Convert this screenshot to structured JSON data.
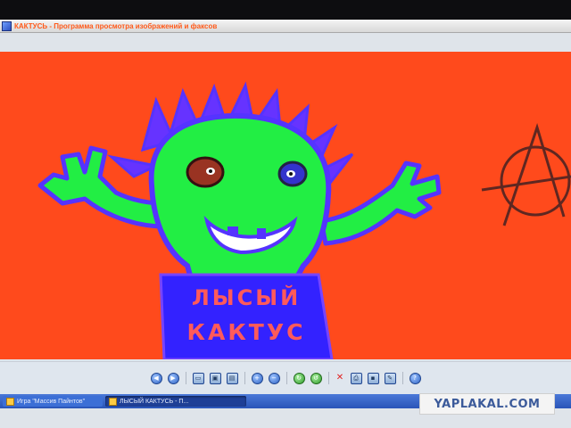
{
  "window": {
    "title": "КАКТУСЬ - Программа просмотра изображений и факсов"
  },
  "image": {
    "pot_line1": "ЛЫСЫЙ",
    "pot_line2": "КАКТУС"
  },
  "toolbar": {
    "buttons": [
      {
        "icon": "previous-image-icon",
        "glyph": "◀"
      },
      {
        "icon": "next-image-icon",
        "glyph": "▶"
      },
      {
        "icon": "best-fit-icon",
        "glyph": "▭"
      },
      {
        "icon": "actual-size-icon",
        "glyph": "▣"
      },
      {
        "icon": "slideshow-icon",
        "glyph": "▤"
      },
      {
        "icon": "zoom-in-icon",
        "glyph": "+"
      },
      {
        "icon": "zoom-out-icon",
        "glyph": "−"
      },
      {
        "icon": "rotate-clockwise-icon",
        "glyph": "↻"
      },
      {
        "icon": "rotate-counterclockwise-icon",
        "glyph": "↺"
      },
      {
        "icon": "delete-icon",
        "glyph": "✕"
      },
      {
        "icon": "print-icon",
        "glyph": "⎙"
      },
      {
        "icon": "save-icon",
        "glyph": "▪"
      },
      {
        "icon": "edit-icon",
        "glyph": "✎"
      },
      {
        "icon": "help-icon",
        "glyph": "?"
      }
    ]
  },
  "taskbar": {
    "items": [
      {
        "label": "Игра \"Массив Пайнтов\"",
        "active": false
      },
      {
        "label": "ЛЫСЫЙ КАКТУСЬ - П...",
        "active": true
      }
    ]
  },
  "watermark": {
    "text": "YAPLAKAL.COM"
  },
  "colors": {
    "canvas_background": "#ff4a1c",
    "cactus_body": "#22ee44",
    "cactus_outline": "#5533ff",
    "pot": "#3322ff",
    "pot_text": "#ff5a5a"
  }
}
